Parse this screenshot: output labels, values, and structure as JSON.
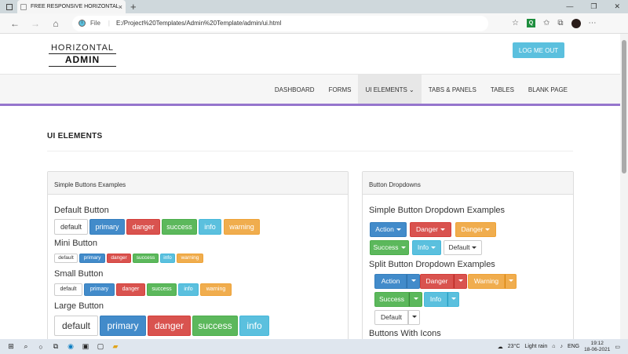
{
  "browser": {
    "tab_title": "FREE RESPONSIVE HORIZONTAL",
    "tab_close": "×",
    "new_tab": "+",
    "url_label": "File",
    "url": "E:/Project%20Templates/Admin%20Template/admin/ui.html",
    "window_controls": [
      "—",
      "❐",
      "✕"
    ]
  },
  "header": {
    "logo_line1": "HORIZONTAL",
    "logo_line2": "ADMIN",
    "logout_label": "LOG ME OUT"
  },
  "menu": {
    "items": [
      "DASHBOARD",
      "FORMS",
      "UI ELEMENTS",
      "TABS & PANELS",
      "TABLES",
      "BLANK PAGE"
    ],
    "active_index": 2
  },
  "page": {
    "title": "UI ELEMENTS"
  },
  "simple_buttons": {
    "panel_title": "Simple Buttons Examples",
    "default_heading": "Default Button",
    "mini_heading": "Mini Button",
    "small_heading": "Small Button",
    "large_heading": "Large Button",
    "labels": [
      "default",
      "primary",
      "danger",
      "success",
      "info",
      "warning"
    ]
  },
  "dropdowns": {
    "panel_title": "Button Dropdowns",
    "simple_heading": "Simple Button Dropdown Examples",
    "simple_labels": [
      "Action",
      "Danger",
      "Danger",
      "Success",
      "Info",
      "Default"
    ],
    "split_heading": "Split Button Dropdown Examples",
    "split_labels": [
      "Action",
      "Danger",
      "Warning",
      "Success",
      "Info",
      "Default"
    ],
    "icons_heading": "Buttons With Icons"
  },
  "taskbar": {
    "weather": "23°C",
    "weather_desc": "Light rain",
    "lang": "ENG",
    "time": "19:12",
    "date": "18-06-2021"
  },
  "colors": {
    "primary": "#428bca",
    "danger": "#d9534f",
    "success": "#5cb85c",
    "info": "#5bc0de",
    "warning": "#f0ad4e",
    "menu_accent": "#9575cd"
  }
}
